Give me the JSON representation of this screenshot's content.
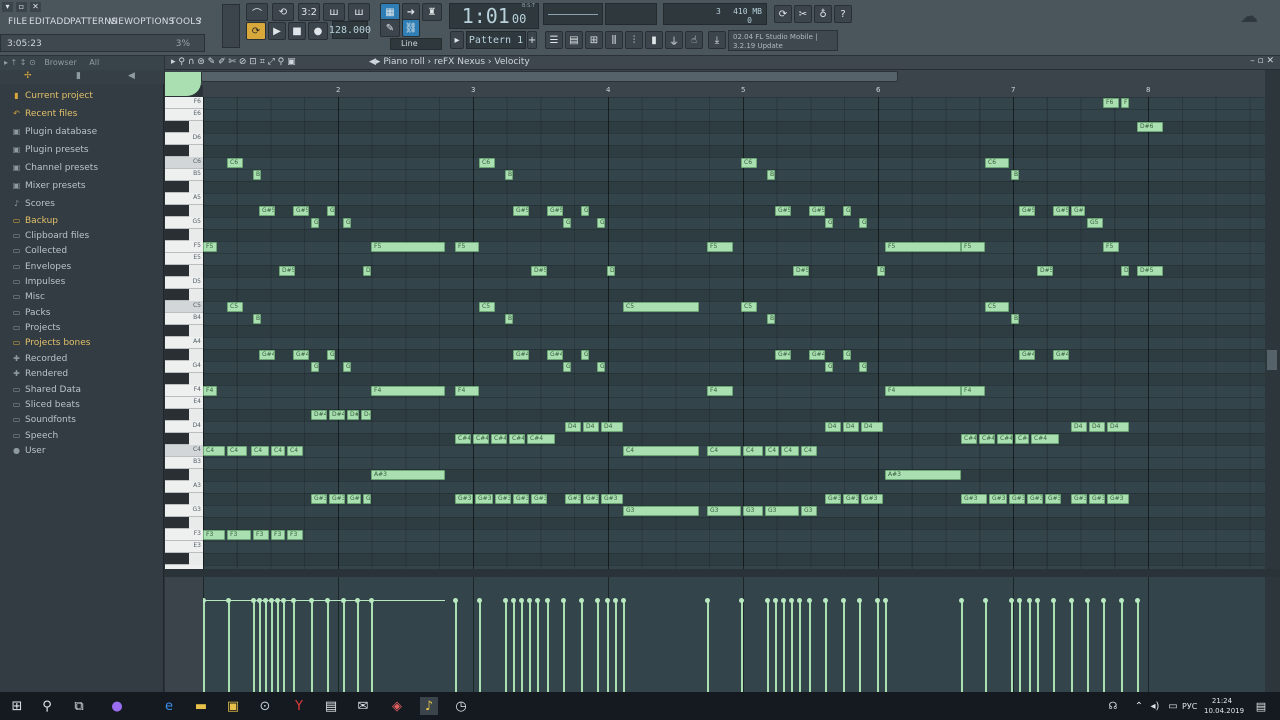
{
  "menu": [
    "FILE",
    "EDIT",
    "ADD",
    "PATTERNS",
    "VIEW",
    "OPTIONS",
    "TOOLS",
    "?"
  ],
  "hint": {
    "time": "3:05:23",
    "percent": "3%"
  },
  "transport": {
    "tempo": "128.000",
    "time": "1:01",
    "time_sub": "00",
    "bst": "B:S:T",
    "pattern": "Pattern 1",
    "snap": "Line",
    "cpu": "3",
    "mem": "410 MB",
    "poly": "0",
    "counter": "3:2"
  },
  "news": {
    "line1": "02.04  FL Studio Mobile |",
    "line2": "3.2.19 Update"
  },
  "browser": {
    "title": "Browser",
    "filter": "All",
    "items": [
      {
        "label": "Current project",
        "icon": "project-icon",
        "highlight": true
      },
      {
        "label": "Recent files",
        "icon": "recent-icon",
        "highlight": true
      },
      {
        "label": "Plugin database",
        "icon": "plugin-db-icon",
        "highlight": false
      },
      {
        "label": "Plugin presets",
        "icon": "plugin-preset-icon",
        "highlight": false
      },
      {
        "label": "Channel presets",
        "icon": "channel-preset-icon",
        "highlight": false
      },
      {
        "label": "Mixer presets",
        "icon": "mixer-preset-icon",
        "highlight": false
      },
      {
        "label": "Scores",
        "icon": "note-icon",
        "highlight": false
      },
      {
        "label": "Backup",
        "icon": "folder-icon",
        "highlight": true
      },
      {
        "label": "Clipboard files",
        "icon": "folder-icon",
        "highlight": false
      },
      {
        "label": "Collected",
        "icon": "folder-icon",
        "highlight": false
      },
      {
        "label": "Envelopes",
        "icon": "folder-icon",
        "highlight": false
      },
      {
        "label": "Impulses",
        "icon": "folder-icon",
        "highlight": false
      },
      {
        "label": "Misc",
        "icon": "folder-icon",
        "highlight": false
      },
      {
        "label": "Packs",
        "icon": "folder-icon",
        "highlight": false
      },
      {
        "label": "Projects",
        "icon": "folder-icon",
        "highlight": false
      },
      {
        "label": "Projects bones",
        "icon": "folder-icon",
        "highlight": true
      },
      {
        "label": "Recorded",
        "icon": "recorded-icon",
        "highlight": false
      },
      {
        "label": "Rendered",
        "icon": "rendered-icon",
        "highlight": false
      },
      {
        "label": "Shared Data",
        "icon": "folder-icon",
        "highlight": false
      },
      {
        "label": "Sliced beats",
        "icon": "folder-icon",
        "highlight": false
      },
      {
        "label": "Soundfonts",
        "icon": "folder-icon",
        "highlight": false
      },
      {
        "label": "Speech",
        "icon": "folder-icon",
        "highlight": false
      },
      {
        "label": "User",
        "icon": "user-icon",
        "highlight": false
      }
    ]
  },
  "pianoroll": {
    "title": "Piano roll",
    "channel": "reFX Nexus",
    "param": "Velocity",
    "bars": [
      "2",
      "3",
      "4",
      "5",
      "6",
      "7",
      "8"
    ],
    "key_labels": [
      "F6",
      "E6",
      "D6",
      "C6",
      "B5",
      "A5",
      "G5",
      "F5",
      "E5",
      "D5",
      "C5",
      "B4",
      "A4",
      "G4",
      "F4",
      "E4",
      "D4",
      "C4",
      "B3",
      "A3",
      "G3",
      "F3",
      "E3"
    ]
  },
  "notes": [
    [
      "F#6",
      76,
      92,
      ""
    ],
    [
      "F#6",
      328,
      344,
      ""
    ],
    [
      "F#6",
      590,
      606,
      ""
    ],
    [
      "F#6",
      834,
      850,
      ""
    ],
    [
      "F6",
      900,
      916,
      ""
    ],
    [
      "F6",
      918,
      926,
      ""
    ],
    [
      "D#6",
      934,
      960,
      ""
    ],
    [
      "C6",
      24,
      40,
      ""
    ],
    [
      "C6",
      276,
      292,
      ""
    ],
    [
      "C6",
      538,
      554,
      ""
    ],
    [
      "C6",
      782,
      806,
      ""
    ],
    [
      "B5",
      50,
      58,
      ""
    ],
    [
      "B5",
      302,
      310,
      ""
    ],
    [
      "B5",
      564,
      572,
      ""
    ],
    [
      "B5",
      808,
      816,
      ""
    ],
    [
      "G#5",
      56,
      72,
      ""
    ],
    [
      "G#5",
      90,
      106,
      ""
    ],
    [
      "G#5",
      124,
      132,
      ""
    ],
    [
      "G#5",
      310,
      326,
      ""
    ],
    [
      "G#5",
      344,
      360,
      ""
    ],
    [
      "G#5",
      378,
      386,
      ""
    ],
    [
      "G#5",
      572,
      588,
      ""
    ],
    [
      "G#5",
      606,
      622,
      ""
    ],
    [
      "G#5",
      640,
      648,
      ""
    ],
    [
      "G#5",
      816,
      832,
      ""
    ],
    [
      "G#5",
      850,
      866,
      ""
    ],
    [
      "G#5",
      868,
      882,
      ""
    ],
    [
      "G5",
      108,
      116,
      ""
    ],
    [
      "G5",
      140,
      148,
      ""
    ],
    [
      "G5",
      360,
      368,
      ""
    ],
    [
      "G5",
      394,
      402,
      ""
    ],
    [
      "G5",
      622,
      630,
      ""
    ],
    [
      "G5",
      656,
      664,
      ""
    ],
    [
      "G5",
      884,
      900,
      ""
    ],
    [
      "F5",
      0,
      14,
      ""
    ],
    [
      "F5",
      168,
      242,
      ""
    ],
    [
      "F5",
      252,
      276,
      ""
    ],
    [
      "F5",
      504,
      530,
      ""
    ],
    [
      "F5",
      682,
      758,
      ""
    ],
    [
      "F5",
      758,
      782,
      ""
    ],
    [
      "F5",
      900,
      916,
      ""
    ],
    [
      "D#5",
      76,
      92,
      ""
    ],
    [
      "D#5",
      160,
      168,
      ""
    ],
    [
      "D#5",
      328,
      344,
      ""
    ],
    [
      "D#5",
      404,
      412,
      ""
    ],
    [
      "D#5",
      590,
      606,
      ""
    ],
    [
      "D#5",
      674,
      682,
      ""
    ],
    [
      "D#5",
      834,
      850,
      ""
    ],
    [
      "D#5",
      918,
      926,
      ""
    ],
    [
      "D#5",
      934,
      960,
      ""
    ],
    [
      "C5",
      24,
      40,
      ""
    ],
    [
      "C5",
      276,
      292,
      ""
    ],
    [
      "C5",
      420,
      496,
      ""
    ],
    [
      "C5",
      538,
      554,
      ""
    ],
    [
      "C5",
      782,
      806,
      ""
    ],
    [
      "B4",
      50,
      58,
      ""
    ],
    [
      "B4",
      302,
      310,
      ""
    ],
    [
      "B4",
      564,
      572,
      ""
    ],
    [
      "B4",
      808,
      816,
      ""
    ],
    [
      "G#4",
      56,
      72,
      ""
    ],
    [
      "G#4",
      90,
      106,
      ""
    ],
    [
      "G#4",
      124,
      132,
      ""
    ],
    [
      "G#4",
      310,
      326,
      ""
    ],
    [
      "G#4",
      344,
      360,
      ""
    ],
    [
      "G#4",
      378,
      386,
      ""
    ],
    [
      "G#4",
      572,
      588,
      ""
    ],
    [
      "G#4",
      606,
      622,
      ""
    ],
    [
      "G#4",
      640,
      648,
      ""
    ],
    [
      "G#4",
      816,
      832,
      ""
    ],
    [
      "G#4",
      850,
      866,
      ""
    ],
    [
      "G4",
      108,
      116,
      ""
    ],
    [
      "G4",
      140,
      148,
      ""
    ],
    [
      "G4",
      360,
      368,
      ""
    ],
    [
      "G4",
      394,
      402,
      ""
    ],
    [
      "G4",
      622,
      630,
      ""
    ],
    [
      "G4",
      656,
      664,
      ""
    ],
    [
      "F4",
      0,
      14,
      ""
    ],
    [
      "F4",
      168,
      242,
      ""
    ],
    [
      "F4",
      252,
      276,
      ""
    ],
    [
      "F4",
      504,
      530,
      ""
    ],
    [
      "F4",
      682,
      758,
      ""
    ],
    [
      "F4",
      758,
      782,
      ""
    ],
    [
      "D#4",
      108,
      124,
      ""
    ],
    [
      "D#4",
      126,
      142,
      ""
    ],
    [
      "D#4",
      144,
      156,
      ""
    ],
    [
      "D#4",
      158,
      168,
      ""
    ],
    [
      "D4",
      362,
      378,
      ""
    ],
    [
      "D4",
      380,
      396,
      ""
    ],
    [
      "D4",
      398,
      420,
      ""
    ],
    [
      "D4",
      622,
      638,
      ""
    ],
    [
      "D4",
      640,
      656,
      ""
    ],
    [
      "D4",
      658,
      680,
      ""
    ],
    [
      "D4",
      868,
      884,
      ""
    ],
    [
      "D4",
      886,
      902,
      ""
    ],
    [
      "D4",
      904,
      926,
      ""
    ],
    [
      "C#4",
      252,
      268,
      ""
    ],
    [
      "C#4",
      270,
      286,
      ""
    ],
    [
      "C#4",
      288,
      304,
      ""
    ],
    [
      "C#4",
      306,
      322,
      ""
    ],
    [
      "C#4",
      324,
      352,
      ""
    ],
    [
      "C#4",
      758,
      774,
      ""
    ],
    [
      "C#4",
      776,
      792,
      ""
    ],
    [
      "C#4",
      794,
      810,
      ""
    ],
    [
      "C#4",
      812,
      826,
      ""
    ],
    [
      "C#4",
      828,
      856,
      ""
    ],
    [
      "C4",
      0,
      22,
      ""
    ],
    [
      "C4",
      24,
      44,
      ""
    ],
    [
      "C4",
      48,
      66,
      ""
    ],
    [
      "C4",
      68,
      82,
      ""
    ],
    [
      "C4",
      84,
      100,
      ""
    ],
    [
      "C4",
      420,
      496,
      ""
    ],
    [
      "C4",
      504,
      538,
      ""
    ],
    [
      "C4",
      540,
      560,
      ""
    ],
    [
      "C4",
      562,
      576,
      ""
    ],
    [
      "C4",
      578,
      596,
      ""
    ],
    [
      "C4",
      598,
      614,
      ""
    ],
    [
      "A#3",
      168,
      242,
      ""
    ],
    [
      "A#3",
      682,
      758,
      ""
    ],
    [
      "G#3",
      108,
      124,
      ""
    ],
    [
      "G#3",
      126,
      142,
      ""
    ],
    [
      "G#3",
      144,
      158,
      ""
    ],
    [
      "G#3",
      160,
      168,
      ""
    ],
    [
      "G#3",
      252,
      270,
      ""
    ],
    [
      "G#3",
      272,
      290,
      ""
    ],
    [
      "G#3",
      292,
      308,
      ""
    ],
    [
      "G#3",
      310,
      326,
      ""
    ],
    [
      "G#3",
      328,
      344,
      ""
    ],
    [
      "G#3",
      362,
      378,
      ""
    ],
    [
      "G#3",
      380,
      396,
      ""
    ],
    [
      "G#3",
      398,
      420,
      ""
    ],
    [
      "G#3",
      622,
      638,
      ""
    ],
    [
      "G#3",
      640,
      656,
      ""
    ],
    [
      "G#3",
      658,
      680,
      ""
    ],
    [
      "G#3",
      758,
      784,
      ""
    ],
    [
      "G#3",
      786,
      804,
      ""
    ],
    [
      "G#3",
      806,
      822,
      ""
    ],
    [
      "G#3",
      824,
      840,
      ""
    ],
    [
      "G#3",
      842,
      858,
      ""
    ],
    [
      "G#3",
      868,
      884,
      ""
    ],
    [
      "G#3",
      886,
      902,
      ""
    ],
    [
      "G#3",
      904,
      926,
      ""
    ],
    [
      "G3",
      420,
      496,
      ""
    ],
    [
      "G3",
      504,
      538,
      ""
    ],
    [
      "G3",
      540,
      560,
      ""
    ],
    [
      "G3",
      562,
      596,
      ""
    ],
    [
      "G3",
      598,
      614,
      ""
    ],
    [
      "F3",
      0,
      22,
      ""
    ],
    [
      "F3",
      24,
      48,
      ""
    ],
    [
      "F3",
      50,
      66,
      ""
    ],
    [
      "F3",
      68,
      82,
      ""
    ],
    [
      "F3",
      84,
      100,
      ""
    ]
  ],
  "velocity": [
    0,
    25,
    50,
    56,
    62,
    68,
    74,
    80,
    90,
    108,
    124,
    140,
    154,
    168,
    252,
    276,
    302,
    310,
    318,
    326,
    334,
    344,
    360,
    378,
    394,
    404,
    412,
    420,
    504,
    538,
    564,
    572,
    580,
    588,
    596,
    606,
    622,
    640,
    656,
    674,
    682,
    758,
    782,
    808,
    816,
    826,
    834,
    850,
    868,
    884,
    900,
    918,
    934
  ],
  "taskbar": {
    "time": "21:24",
    "date": "10.04.2019",
    "lang": "РУС"
  }
}
